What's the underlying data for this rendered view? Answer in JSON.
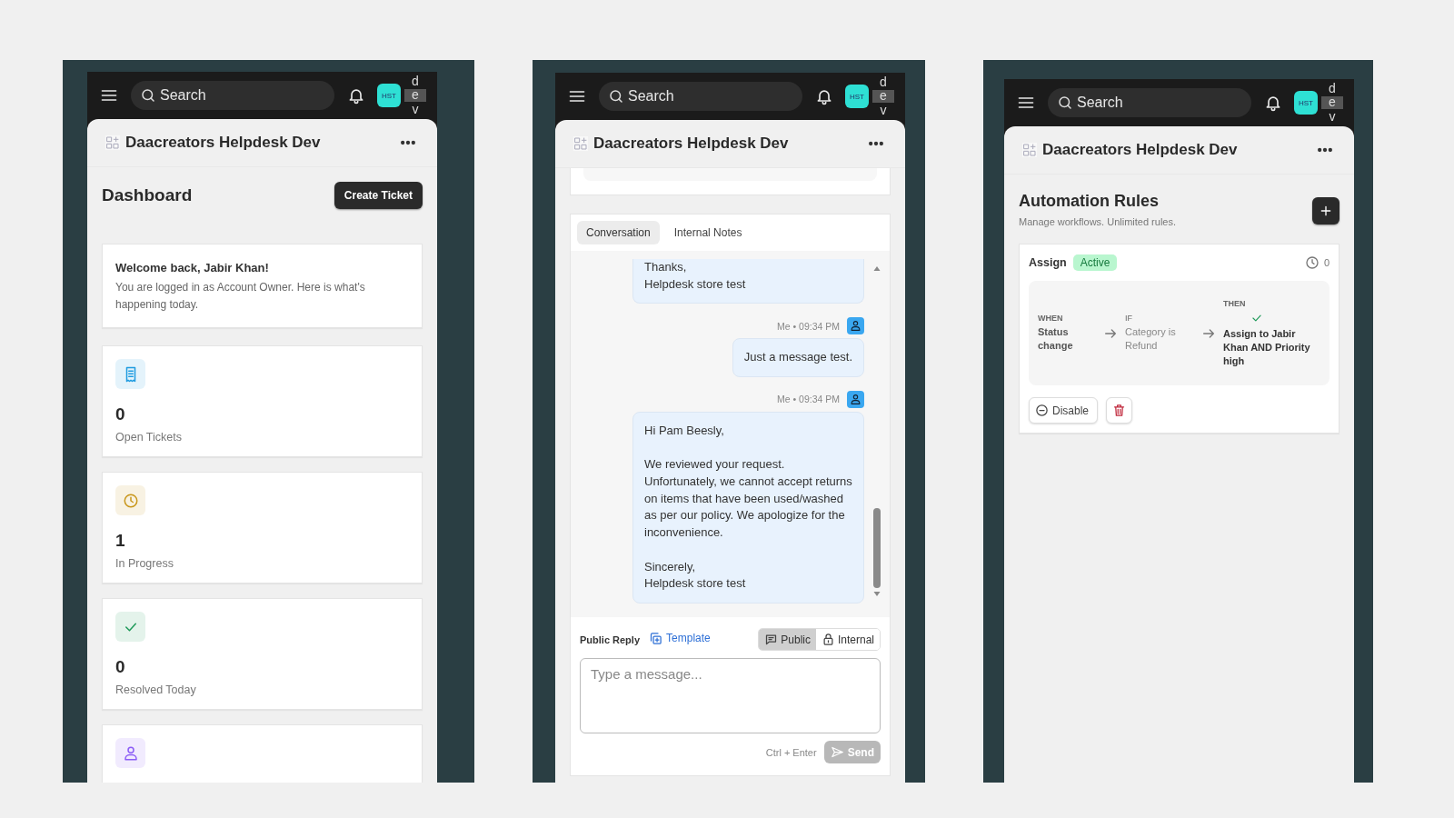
{
  "screens": [
    {
      "kind": "dashboard",
      "topbar": {
        "search_placeholder": "Search",
        "avatar": "HST",
        "env": "dev"
      },
      "header": {
        "title": "Daacreators Helpdesk Dev"
      },
      "page_title": "Dashboard",
      "primary_button": "Create Ticket",
      "welcome": {
        "title": "Welcome back, Jabir Khan!",
        "text": "You are logged in as Account Owner. Here is what's happening today."
      },
      "stats": [
        {
          "kind": "tickets",
          "color": "#1e9be0",
          "value": "0",
          "label": "Open Tickets"
        },
        {
          "kind": "clock",
          "color": "#c8961a",
          "value": "1",
          "label": "In Progress"
        },
        {
          "kind": "check",
          "color": "#1f9a5a",
          "value": "0",
          "label": "Resolved Today"
        },
        {
          "kind": "person",
          "color": "#8b5cf6"
        }
      ]
    },
    {
      "kind": "ticket",
      "topbar": {
        "search_placeholder": "Search",
        "avatar": "HST",
        "env": "dev"
      },
      "header": {
        "title": "Daacreators Helpdesk Dev"
      },
      "tabs": [
        {
          "label": "Conversation",
          "selected": true
        },
        {
          "label": "Internal Notes",
          "selected": false
        }
      ],
      "messages": [
        {
          "text": "Thanks,\nHelpdesk store test",
          "cut": true
        },
        {
          "meta": "Me • 09:34 PM",
          "text": "Just a message test.",
          "cut": false
        },
        {
          "meta": "Me • 09:34 PM",
          "text": "Hi Pam Beesly,\n\nWe reviewed your request. Unfortunately, we cannot accept returns on items that have been used/washed as per our policy. We apologize for the inconvenience.\n\nSincerely,\nHelpdesk store test",
          "cut": false
        }
      ],
      "reply": {
        "label": "Public Reply",
        "template": "Template",
        "modes": [
          {
            "kind": "public",
            "label": "Public",
            "selected": true
          },
          {
            "kind": "internal",
            "label": "Internal",
            "selected": false
          }
        ],
        "placeholder": "Type a message...",
        "hint": "Ctrl + Enter",
        "send": {
          "label": "Send",
          "disabled": true
        }
      }
    },
    {
      "kind": "automation",
      "topbar": {
        "search_placeholder": "Search",
        "avatar": "HST",
        "env": "dev"
      },
      "header": {
        "title": "Daacreators Helpdesk Dev"
      },
      "page_title": "Automation Rules",
      "subtitle": "Manage workflows. Unlimited rules.",
      "rules": [
        {
          "name": "Assign",
          "status": "Active",
          "active": true,
          "runs": "0",
          "steps": [
            {
              "kind": "when",
              "label": "WHEN",
              "text": "Status change"
            },
            {
              "kind": "if",
              "label": "IF",
              "text": "Category is Refund"
            },
            {
              "kind": "then",
              "label": "THEN",
              "text": "Assign to Jabir Khan AND Priority high"
            }
          ],
          "toggle_label": "Disable"
        }
      ]
    }
  ]
}
